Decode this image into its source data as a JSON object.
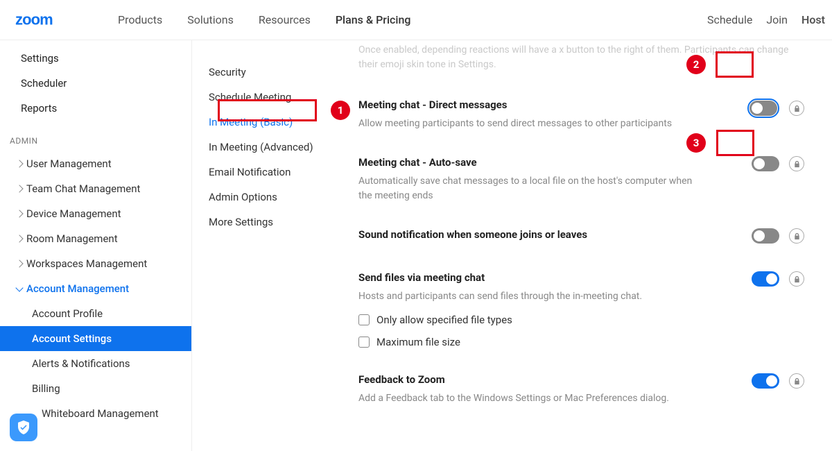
{
  "header": {
    "logo_text": "zoom",
    "nav": [
      "Products",
      "Solutions",
      "Resources",
      "Plans & Pricing"
    ],
    "right": {
      "schedule": "Schedule",
      "join": "Join",
      "host": "Host"
    }
  },
  "sidebar": {
    "top": [
      "Settings",
      "Scheduler",
      "Reports"
    ],
    "section_label": "ADMIN",
    "admin": [
      {
        "label": "User Management"
      },
      {
        "label": "Team Chat Management"
      },
      {
        "label": "Device Management"
      },
      {
        "label": "Room Management"
      },
      {
        "label": "Workspaces Management"
      },
      {
        "label": "Account Management",
        "expanded": true,
        "children": [
          {
            "label": "Account Profile"
          },
          {
            "label": "Account Settings",
            "active": true
          },
          {
            "label": "Alerts & Notifications"
          },
          {
            "label": "Billing"
          },
          {
            "label": "Whiteboard Management"
          }
        ]
      }
    ]
  },
  "tabs": [
    "Security",
    "Schedule Meeting",
    "In Meeting (Basic)",
    "In Meeting (Advanced)",
    "Email Notification",
    "Admin Options",
    "More Settings"
  ],
  "active_tab": "In Meeting (Basic)",
  "faded_hint": "Once enabled, depending reactions will have a x button to the right of them. Participants can change their emoji skin tone in Settings.",
  "settings": [
    {
      "title": "Meeting chat - Direct messages",
      "desc": "Allow meeting participants to send direct messages to other participants",
      "on": false,
      "focused": true
    },
    {
      "title": "Meeting chat - Auto-save",
      "desc": "Automatically save chat messages to a local file on the host's computer when the meeting ends",
      "on": false
    },
    {
      "title": "Sound notification when someone joins or leaves",
      "desc": "",
      "on": false
    },
    {
      "title": "Send files via meeting chat",
      "desc": "Hosts and participants can send files through the in-meeting chat.",
      "on": true,
      "checks": [
        "Only allow specified file types",
        "Maximum file size"
      ]
    },
    {
      "title": "Feedback to Zoom",
      "desc": "Add a Feedback tab to the Windows Settings or Mac Preferences dialog.",
      "on": true
    }
  ],
  "badges": {
    "b1": "1",
    "b2": "2",
    "b3": "3"
  },
  "colors": {
    "accent": "#0e72ed",
    "danger": "#e1001a"
  }
}
